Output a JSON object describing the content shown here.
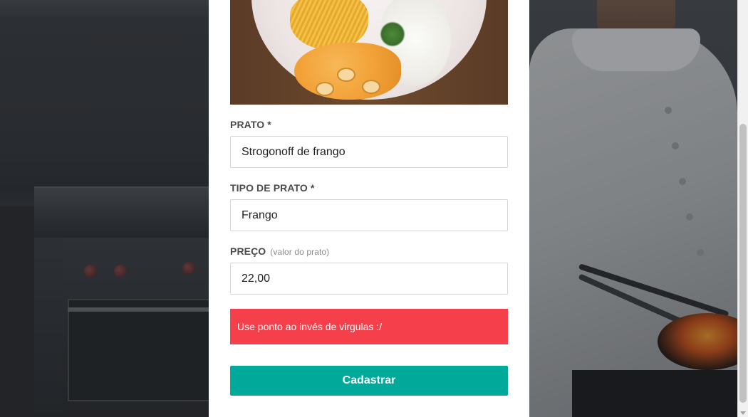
{
  "form": {
    "prato": {
      "label": "PRATO *",
      "value": "Strogonoff de frango"
    },
    "tipo": {
      "label": "TIPO DE PRATO *",
      "value": "Frango"
    },
    "preco": {
      "label": "PREÇO",
      "hint": "(valor do prato)",
      "value": "22,00"
    },
    "error_message": "Use ponto ao invés de virgulas :/",
    "submit_label": "Cadastrar"
  },
  "colors": {
    "error_bg": "#f5404c",
    "submit_bg": "#00a99a",
    "card_bg": "#ffffff"
  },
  "icons": {
    "dish_image": "strogonoff-photo"
  }
}
